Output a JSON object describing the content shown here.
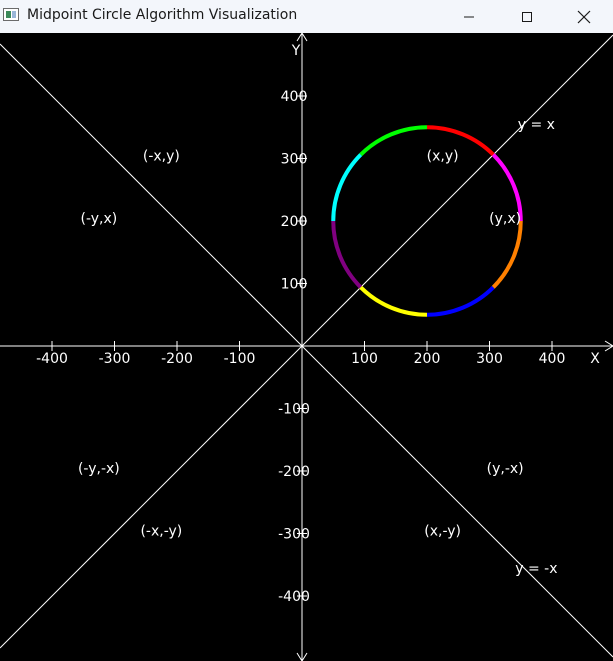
{
  "window": {
    "title": "Midpoint Circle Algorithm Visualization",
    "icon": "app-window-icon",
    "controls": {
      "minimize_icon": "minimize-icon",
      "maximize_icon": "maximize-icon",
      "close_icon": "close-icon"
    }
  },
  "plot": {
    "background": "#000000",
    "line_color": "#ffffff",
    "axis_labels": {
      "x": "X",
      "y": "Y"
    },
    "x_ticks": [
      {
        "value": -400,
        "label": "-400"
      },
      {
        "value": -300,
        "label": "-300"
      },
      {
        "value": -200,
        "label": "-200"
      },
      {
        "value": -100,
        "label": "-100"
      },
      {
        "value": 100,
        "label": "100"
      },
      {
        "value": 200,
        "label": "200"
      },
      {
        "value": 300,
        "label": "300"
      },
      {
        "value": 400,
        "label": "400"
      }
    ],
    "y_ticks": [
      {
        "value": 400,
        "label": "400"
      },
      {
        "value": 300,
        "label": "300"
      },
      {
        "value": 200,
        "label": "200"
      },
      {
        "value": 100,
        "label": "100"
      },
      {
        "value": -100,
        "label": "-100"
      },
      {
        "value": -200,
        "label": "-200"
      },
      {
        "value": -300,
        "label": "-300"
      },
      {
        "value": -400,
        "label": "-400"
      }
    ],
    "diagonals": [
      {
        "name": "diagonal-y-equals-x",
        "label": "y = x",
        "label_x": 375,
        "label_y": 355
      },
      {
        "name": "diagonal-y-equals-neg-x",
        "label": "y = -x",
        "label_x": 375,
        "label_y": -355
      }
    ],
    "octant_labels": [
      {
        "name": "octant-label-x-y",
        "text": "(x,y)",
        "x": 225,
        "y": 305
      },
      {
        "name": "octant-label-y-x",
        "text": "(y,x)",
        "x": 325,
        "y": 205
      },
      {
        "name": "octant-label-negx-y",
        "text": "(-x,y)",
        "x": -225,
        "y": 305
      },
      {
        "name": "octant-label-negy-x",
        "text": "(-y,x)",
        "x": -325,
        "y": 205
      },
      {
        "name": "octant-label-negy-negx",
        "text": "(-y,-x)",
        "x": -325,
        "y": -195
      },
      {
        "name": "octant-label-negx-negy",
        "text": "(-x,-y)",
        "x": -225,
        "y": -295
      },
      {
        "name": "octant-label-x-negy",
        "text": "(x,-y)",
        "x": 225,
        "y": -295
      },
      {
        "name": "octant-label-y-negx",
        "text": "(y,-x)",
        "x": 325,
        "y": -195
      }
    ]
  },
  "chart_data": {
    "type": "scatter",
    "circle": {
      "center": [
        200,
        200
      ],
      "radius": 150
    },
    "xlim": [
      -480,
      495
    ],
    "ylim": [
      -500,
      495
    ],
    "grid": false,
    "octant_arcs": [
      {
        "name": "octant-1",
        "color": "#ff0000",
        "from_deg": 45,
        "to_deg": 90
      },
      {
        "name": "octant-2",
        "color": "#00ff00",
        "from_deg": 90,
        "to_deg": 135
      },
      {
        "name": "octant-3",
        "color": "#00ffff",
        "from_deg": 135,
        "to_deg": 180
      },
      {
        "name": "octant-4",
        "color": "#800080",
        "from_deg": 180,
        "to_deg": 225
      },
      {
        "name": "octant-5",
        "color": "#ffff00",
        "from_deg": 225,
        "to_deg": 270
      },
      {
        "name": "octant-6",
        "color": "#0000ff",
        "from_deg": 270,
        "to_deg": 315
      },
      {
        "name": "octant-7",
        "color": "#ff8000",
        "from_deg": 315,
        "to_deg": 360
      },
      {
        "name": "octant-8",
        "color": "#ff00ff",
        "from_deg": 0,
        "to_deg": 45
      }
    ]
  }
}
